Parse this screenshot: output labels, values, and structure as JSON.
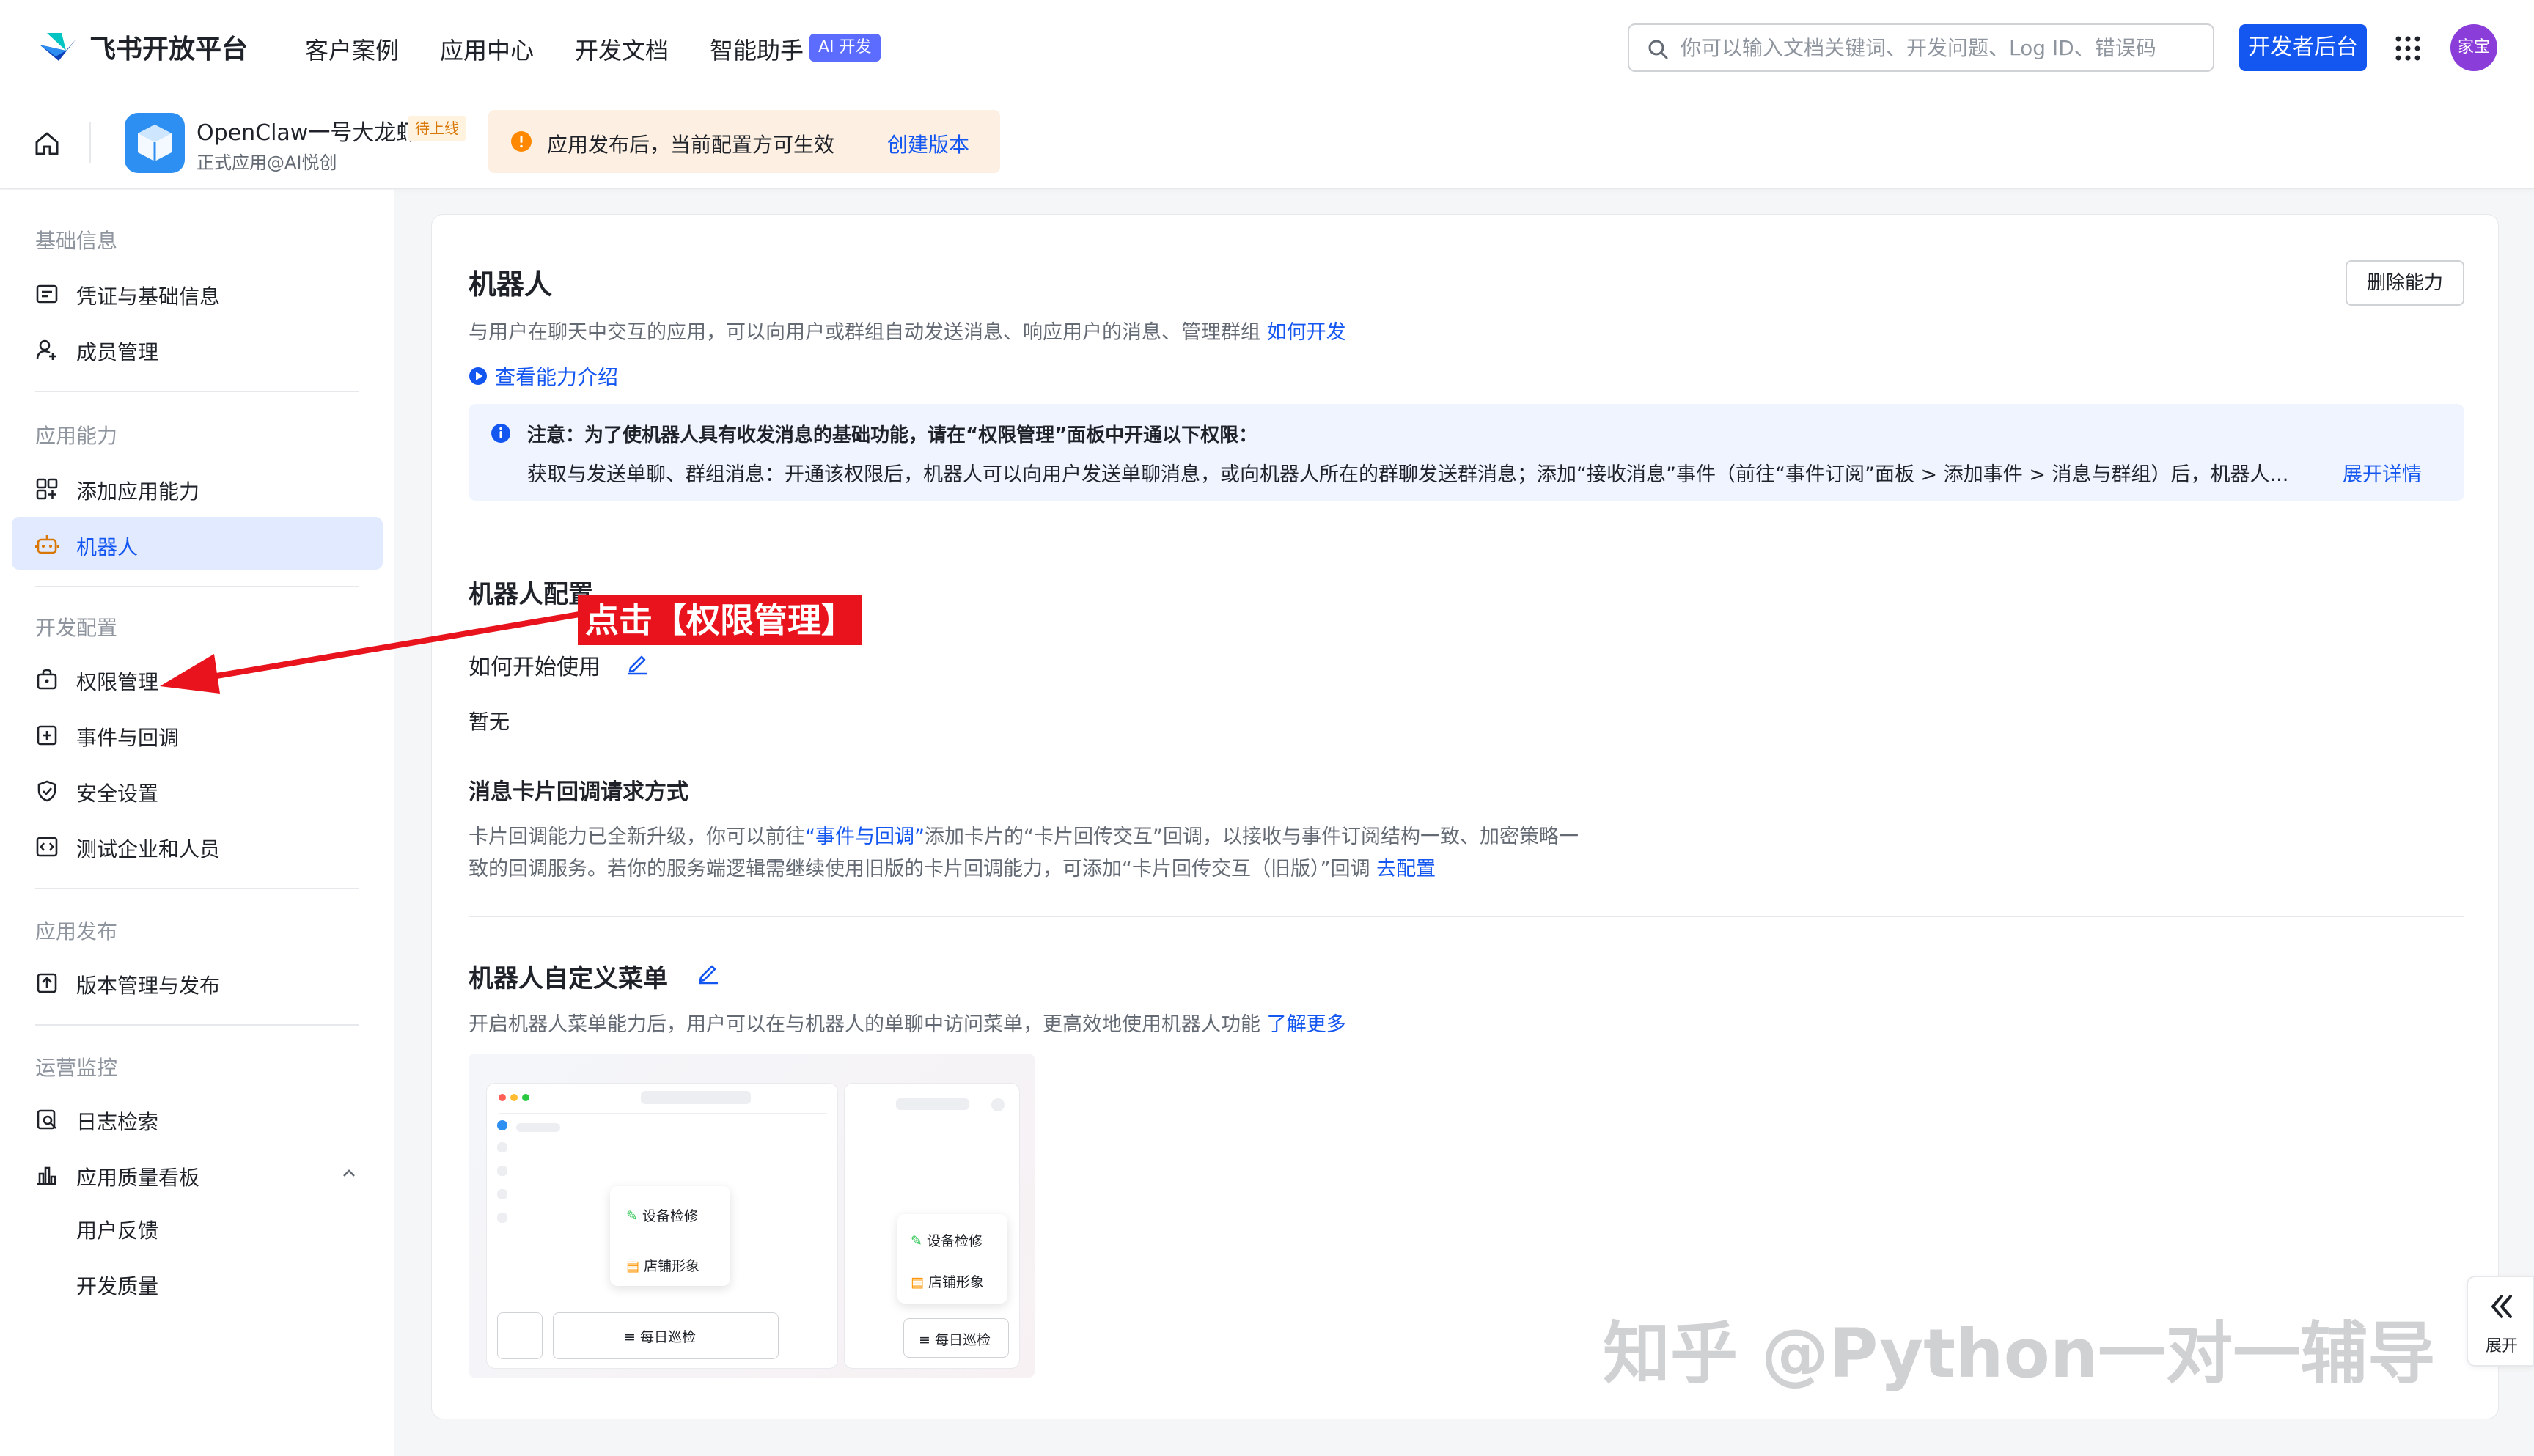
{
  "topnav": {
    "brand": "飞书开放平台",
    "links": [
      "客户案例",
      "应用中心",
      "开发文档",
      "智能助手"
    ],
    "ai_badge": "AI 开发",
    "search_placeholder": "你可以输入文档关键词、开发问题、Log ID、错误码",
    "dev_button": "开发者后台",
    "avatar_text": "家宝"
  },
  "apphead": {
    "app_name": "OpenClaw一号大龙虾",
    "app_status": "待上线",
    "app_sub": "正式应用@AI悦创",
    "notice_text": "应用发布后，当前配置方可生效",
    "notice_link": "创建版本"
  },
  "sidebar": {
    "groups": [
      "基础信息",
      "应用能力",
      "开发配置",
      "应用发布",
      "运营监控"
    ],
    "items": [
      {
        "label": "凭证与基础信息"
      },
      {
        "label": "成员管理"
      },
      {
        "label": "添加应用能力"
      },
      {
        "label": "机器人"
      },
      {
        "label": "权限管理"
      },
      {
        "label": "事件与回调"
      },
      {
        "label": "安全设置"
      },
      {
        "label": "测试企业和人员"
      },
      {
        "label": "版本管理与发布"
      },
      {
        "label": "日志检索"
      },
      {
        "label": "应用质量看板"
      }
    ],
    "subitems": [
      "用户反馈",
      "开发质量"
    ]
  },
  "card": {
    "title": "机器人",
    "delete_button": "删除能力",
    "desc": "与用户在聊天中交互的应用，可以向用户或群组自动发送消息、响应用户的消息、管理群组",
    "desc_link": "如何开发",
    "intro_link": "查看能力介绍",
    "tip_title": "注意：为了使机器人具有收发消息的基础功能，请在“权限管理”面板中开通以下权限：",
    "tip_body": "获取与发送单聊、群组消息：开通该权限后，机器人可以向用户发送单聊消息，或向机器人所在的群聊发送群消息；添加“接收消息”事件（前往“事件订阅”面板 > 添加事件 > 消息与群组）后，机器人...",
    "tip_more": "展开详情",
    "config_title": "机器人配置",
    "how_to_start": "如何开始使用",
    "none_text": "暂无",
    "card_callback_title": "消息卡片回调请求方式",
    "card_callback_desc1a": "卡片回调能力已全新升级，你可以前往",
    "card_callback_desc1_link": "“事件与回调”",
    "card_callback_desc1b": "添加卡片的“卡片回传交互”回调，以接收与事件订阅结构一致、加密策略一",
    "card_callback_desc2": "致的回调服务。若你的服务端逻辑需继续使用旧版的卡片回调能力，可添加“卡片回传交互（旧版）”回调",
    "card_callback_link": "去配置",
    "menu_title": "机器人自定义菜单",
    "menu_desc": "开启机器人菜单能力后，用户可以在与机器人的单聊中访问菜单，更高效地使用机器人功能",
    "menu_link": "了解更多",
    "preview": {
      "menu_items": [
        "设备检修",
        "店铺形象"
      ],
      "input_label": "每日巡检"
    }
  },
  "annotation": {
    "callout": "点击【权限管理】"
  },
  "watermark": "知乎 @Python一对一辅导",
  "expand_label": "展开",
  "colors": {
    "accent": "#1456f0",
    "active_bg": "#e1eaff",
    "callout_red": "#e8131c"
  }
}
